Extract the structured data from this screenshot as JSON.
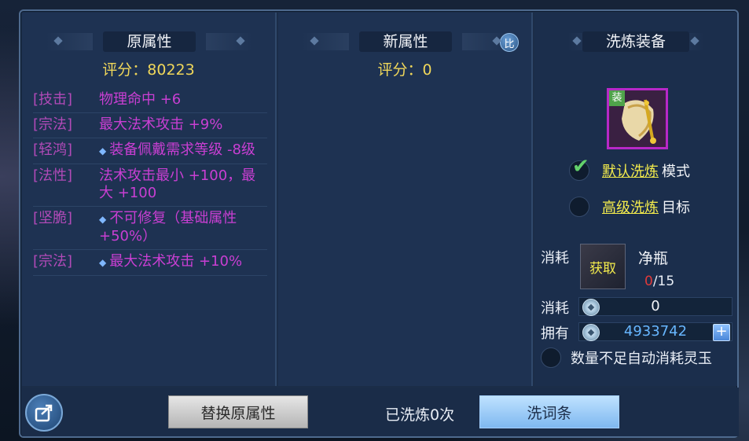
{
  "left_panel": {
    "title": "原属性",
    "score": "评分：80223",
    "attributes": [
      {
        "tag": "[技击]",
        "value": "物理命中 +6",
        "dot": false
      },
      {
        "tag": "[宗法]",
        "value": "最大法术攻击 +9%",
        "dot": false
      },
      {
        "tag": "[轻鸿]",
        "value": "装备佩戴需求等级 -8级",
        "dot": true
      },
      {
        "tag": "[法性]",
        "value": "法术攻击最小 +100，最大 +100",
        "dot": false
      },
      {
        "tag": "[坚脆]",
        "value": "不可修复（基础属性+50%）",
        "dot": true
      },
      {
        "tag": "[宗法]",
        "value": "最大法术攻击 +10%",
        "dot": true
      }
    ]
  },
  "mid_panel": {
    "title": "新属性",
    "score": "评分：0",
    "compare_label": "比"
  },
  "right_panel": {
    "title": "洗炼装备",
    "equip_tag": "装",
    "mode_default": {
      "link": "默认洗炼",
      "suffix": "模式",
      "checked": true
    },
    "mode_advanced": {
      "link": "高级洗炼",
      "suffix": "目标",
      "checked": false
    },
    "cost_label_1": "消耗",
    "item_slot_text": "获取",
    "item_name": "净瓶",
    "item_have": "0",
    "item_need": "/15",
    "cost_label_2": "消耗",
    "cost_value": "0",
    "own_label": "拥有",
    "own_value": "4933742",
    "plus_label": "+",
    "auto_consume": "数量不足自动消耗灵玉"
  },
  "bottom": {
    "replace_btn": "替换原属性",
    "washed_text": "已洗炼0次",
    "wash_btn": "洗词条"
  },
  "colors": {
    "score": "#f0d75a",
    "attr_tag": "#b14ab8",
    "attr_val": "#c93fd3",
    "link": "#f4ec4c",
    "own_value": "#67b6ff"
  }
}
